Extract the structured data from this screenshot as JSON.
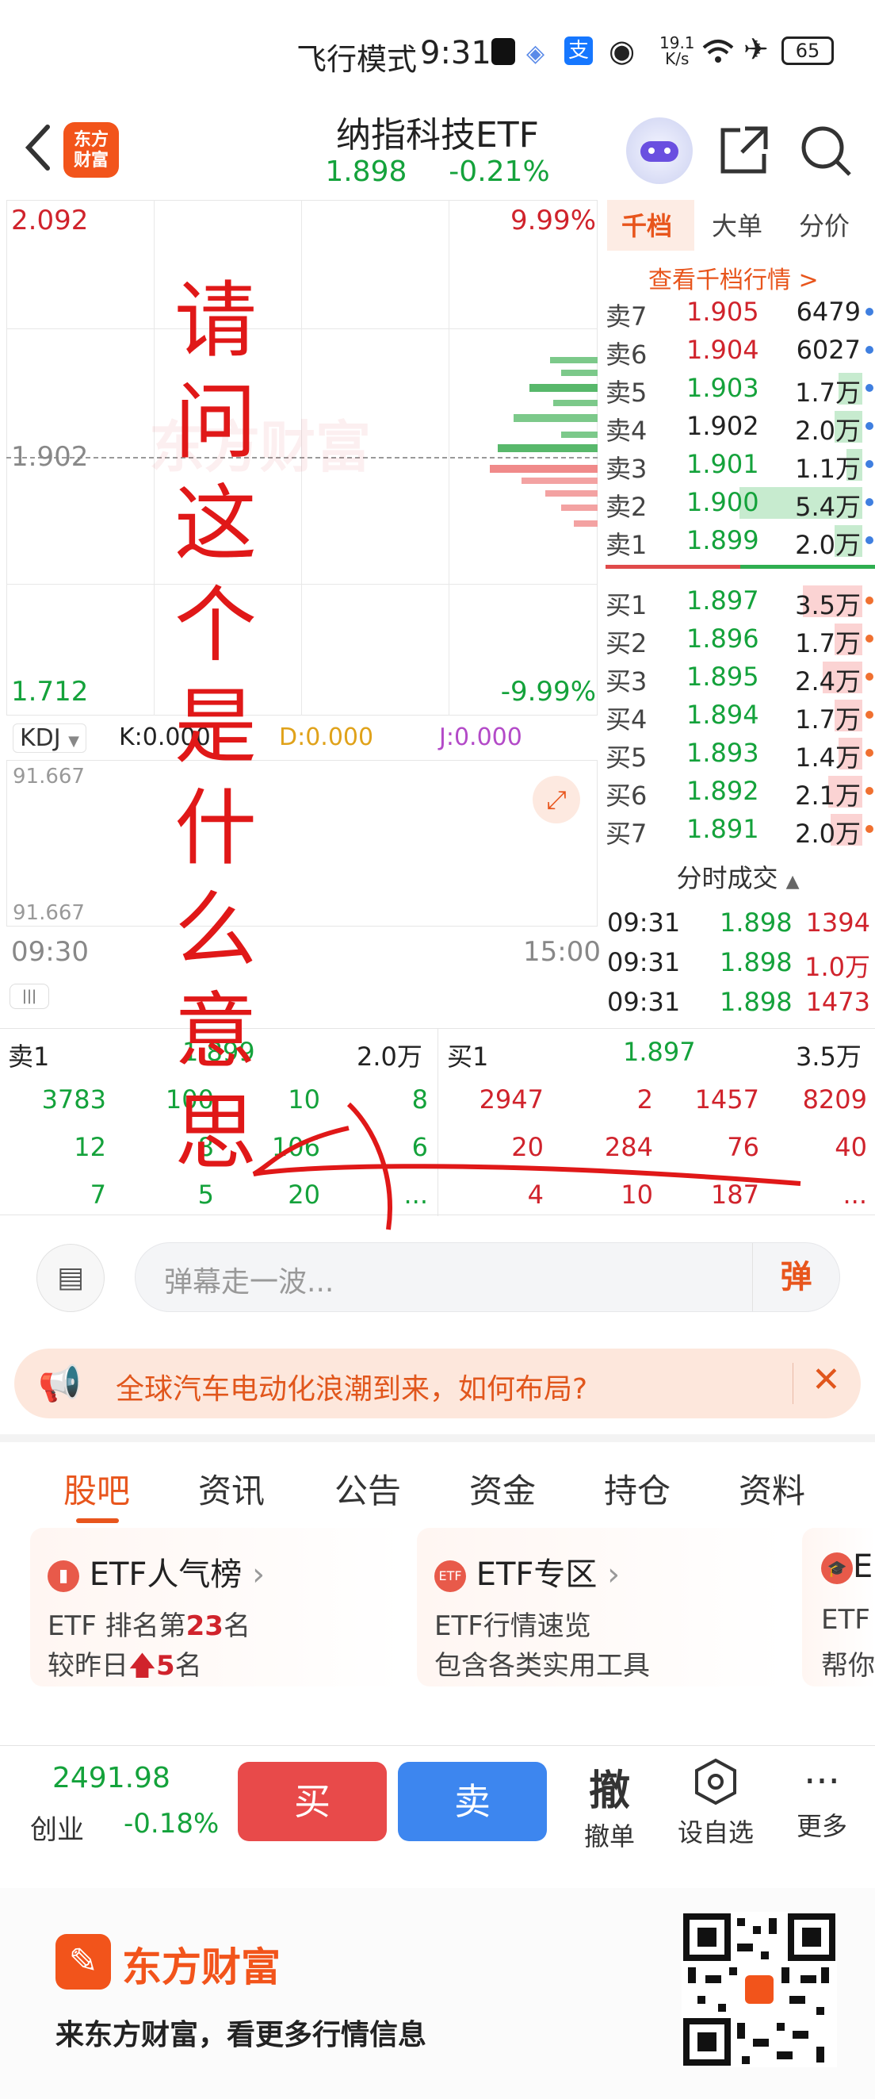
{
  "status_bar": {
    "airplane_label": "飞行模式",
    "time": "9:31",
    "speed_top": "19.1",
    "speed_bottom": "K/s",
    "battery": "65"
  },
  "header": {
    "logo_text_top": "东方",
    "logo_text_bottom": "财富",
    "title": "纳指科技ETF",
    "price": "1.898",
    "change_pct": "-0.21%"
  },
  "chart": {
    "high_price": "2.092",
    "high_pct": "9.99%",
    "mid_price": "1.902",
    "low_price": "1.712",
    "low_pct": "-9.99%",
    "watermark": "东方财富",
    "kdj": {
      "selector": "KDJ",
      "k": "K:0.000",
      "d": "D:0.000",
      "j": "J:0.000",
      "top_value": "91.667",
      "bottom_value": "91.667"
    },
    "time_start": "09:30",
    "time_end": "15:00",
    "handwriting": "请问这个是什么意思"
  },
  "order_book": {
    "tabs": [
      "千档",
      "大单",
      "分价"
    ],
    "view_all": "查看千档行情 >",
    "sells": [
      {
        "label": "卖7",
        "price": "1.905",
        "vol": "6479",
        "bar": 0.0
      },
      {
        "label": "卖6",
        "price": "1.904",
        "vol": "6027",
        "bar": 0.0
      },
      {
        "label": "卖5",
        "price": "1.903",
        "vol": "1.7万",
        "bar": 0.12
      },
      {
        "label": "卖4",
        "price": "1.902",
        "vol": "2.0万",
        "bar": 0.14
      },
      {
        "label": "卖3",
        "price": "1.901",
        "vol": "1.1万",
        "bar": 0.08
      },
      {
        "label": "卖2",
        "price": "1.900",
        "vol": "5.4万",
        "bar": 0.62
      },
      {
        "label": "卖1",
        "price": "1.899",
        "vol": "2.0万",
        "bar": 0.14
      }
    ],
    "buys": [
      {
        "label": "买1",
        "price": "1.897",
        "vol": "3.5万",
        "bar": 0.3
      },
      {
        "label": "买2",
        "price": "1.896",
        "vol": "1.7万",
        "bar": 0.14
      },
      {
        "label": "买3",
        "price": "1.895",
        "vol": "2.4万",
        "bar": 0.2
      },
      {
        "label": "买4",
        "price": "1.894",
        "vol": "1.7万",
        "bar": 0.14
      },
      {
        "label": "买5",
        "price": "1.893",
        "vol": "1.4万",
        "bar": 0.12
      },
      {
        "label": "买6",
        "price": "1.892",
        "vol": "2.1万",
        "bar": 0.17
      },
      {
        "label": "买7",
        "price": "1.891",
        "vol": "2.0万",
        "bar": 0.16
      }
    ],
    "ticks_title": "分时成交",
    "ticks": [
      {
        "time": "09:31",
        "price": "1.898",
        "vol": "1394"
      },
      {
        "time": "09:31",
        "price": "1.898",
        "vol": "1.0万"
      },
      {
        "time": "09:31",
        "price": "1.898",
        "vol": "1473"
      }
    ]
  },
  "trade_summary": {
    "sell1_label": "卖1",
    "sell1_price": "1.899",
    "sell1_vol": "2.0万",
    "buy1_label": "买1",
    "buy1_price": "1.897",
    "buy1_vol": "3.5万",
    "left_rows": [
      [
        "3783",
        "100",
        "10",
        "8"
      ],
      [
        "12",
        "8",
        "106",
        "6"
      ],
      [
        "7",
        "5",
        "20",
        "..."
      ]
    ],
    "right_rows": [
      [
        "2947",
        "2",
        "1457",
        "8209"
      ],
      [
        "20",
        "284",
        "76",
        "40"
      ],
      [
        "4",
        "10",
        "187",
        "..."
      ]
    ]
  },
  "danmu": {
    "placeholder": "弹幕走一波...",
    "send_label": "弹"
  },
  "notice": {
    "message": "全球汽车电动化浪潮到来，如何布局?"
  },
  "info_tabs": [
    "股吧",
    "资讯",
    "公告",
    "资金",
    "持仓",
    "资料"
  ],
  "cards": [
    {
      "title": "ETF人气榜",
      "line1_prefix": "ETF 排名第",
      "line1_num": "23",
      "line1_suffix": "名",
      "line2_prefix": "较昨日",
      "line2_num": "5",
      "line2_suffix": "名"
    },
    {
      "title": "ETF专区",
      "line1": "ETF行情速览",
      "line2": "包含各类实用工具"
    },
    {
      "title": "E",
      "line1": "ETF",
      "line2": "帮你"
    }
  ],
  "bottom_bar": {
    "index_value": "2491.98",
    "index_name": "创业",
    "index_change": "-0.18%",
    "buy_label": "买",
    "sell_label": "卖",
    "cancel_icon": "撤",
    "cancel_label": "撤单",
    "watchlist_label": "设自选",
    "more_label": "更多"
  },
  "promo": {
    "brand": "东方财富",
    "slogan": "来东方财富，看更多行情信息"
  },
  "colors": {
    "up": "#d0232c",
    "down": "#14a23b",
    "brand": "#f2541b",
    "accent_blue": "#3f7fe0"
  }
}
